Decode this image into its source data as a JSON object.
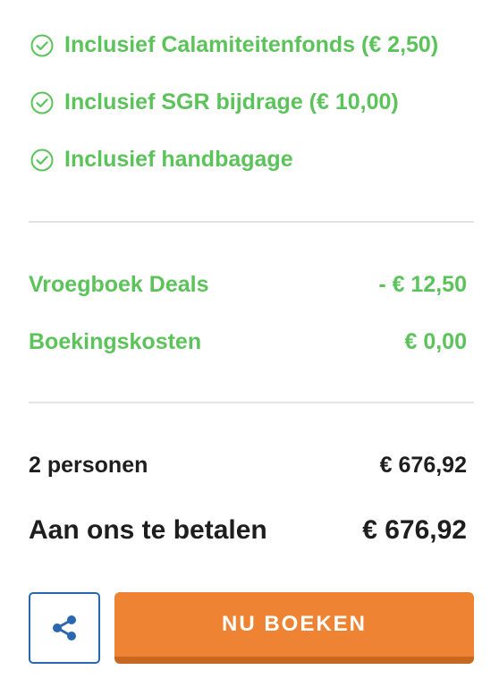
{
  "inclusions": [
    {
      "label": "Inclusief Calamiteitenfonds (€ 2,50)",
      "icon": "check-circle-icon"
    },
    {
      "label": "Inclusief SGR bijdrage (€ 10,00)",
      "icon": "check-circle-icon"
    },
    {
      "label": "Inclusief handbagage",
      "icon": "check-circle-icon"
    }
  ],
  "discounts": {
    "deals_label": "Vroegboek Deals",
    "deals_value": "- € 12,50",
    "costs_label": "Boekingskosten",
    "costs_value": "€ 0,00"
  },
  "summary": {
    "persons_label": "2 personen",
    "persons_value": "€ 676,92",
    "total_label": "Aan ons te betalen",
    "total_value": "€ 676,92"
  },
  "actions": {
    "share_icon": "share-icon",
    "book_label": "NU BOEKEN"
  },
  "colors": {
    "green": "#5cc35a",
    "orange": "#ee8433",
    "blue": "#2b66b0",
    "text": "#1e1e1e"
  }
}
